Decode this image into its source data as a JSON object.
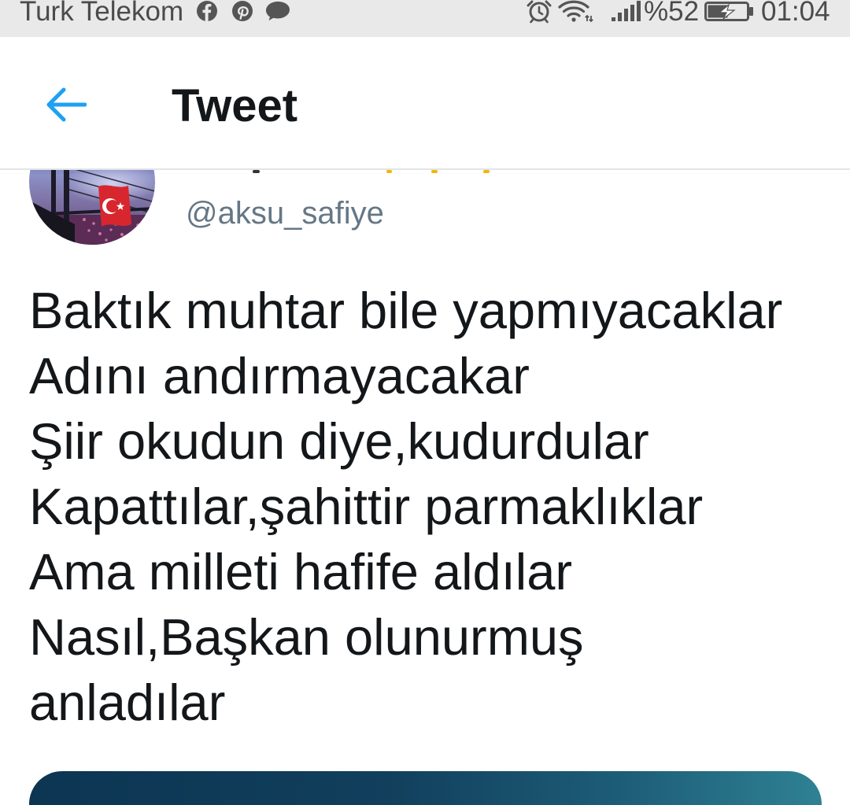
{
  "status_bar": {
    "carrier": "Turk Telekom",
    "notification_icons": [
      "facebook-icon",
      "pinterest-icon",
      "message-icon"
    ],
    "system_icons": [
      "alarm-icon",
      "wifi-icon",
      "signal-icon",
      "battery-charging-icon"
    ],
    "battery_text": "%52",
    "battery_level": 0.52,
    "time": "01:04"
  },
  "header": {
    "back_icon": "arrow-left-icon",
    "title": "Tweet"
  },
  "tweet": {
    "handle": "@aksu_safiye",
    "lines": [
      "Baktık muhtar bile yapmıyacaklar",
      "Adını andırmayacakar",
      "Şiir okudun diye,kudurdular",
      "Kapattılar,şahittir parmaklıklar",
      "Ama milleti hafife aldılar",
      "Nasıl,Başkan olunurmuş",
      "anladılar"
    ]
  },
  "colors": {
    "accent": "#1da1f2",
    "text": "#14171a",
    "handle": "#657786",
    "status_bar_bg": "#e9e9e9",
    "status_bar_text": "#4b4b4b"
  }
}
